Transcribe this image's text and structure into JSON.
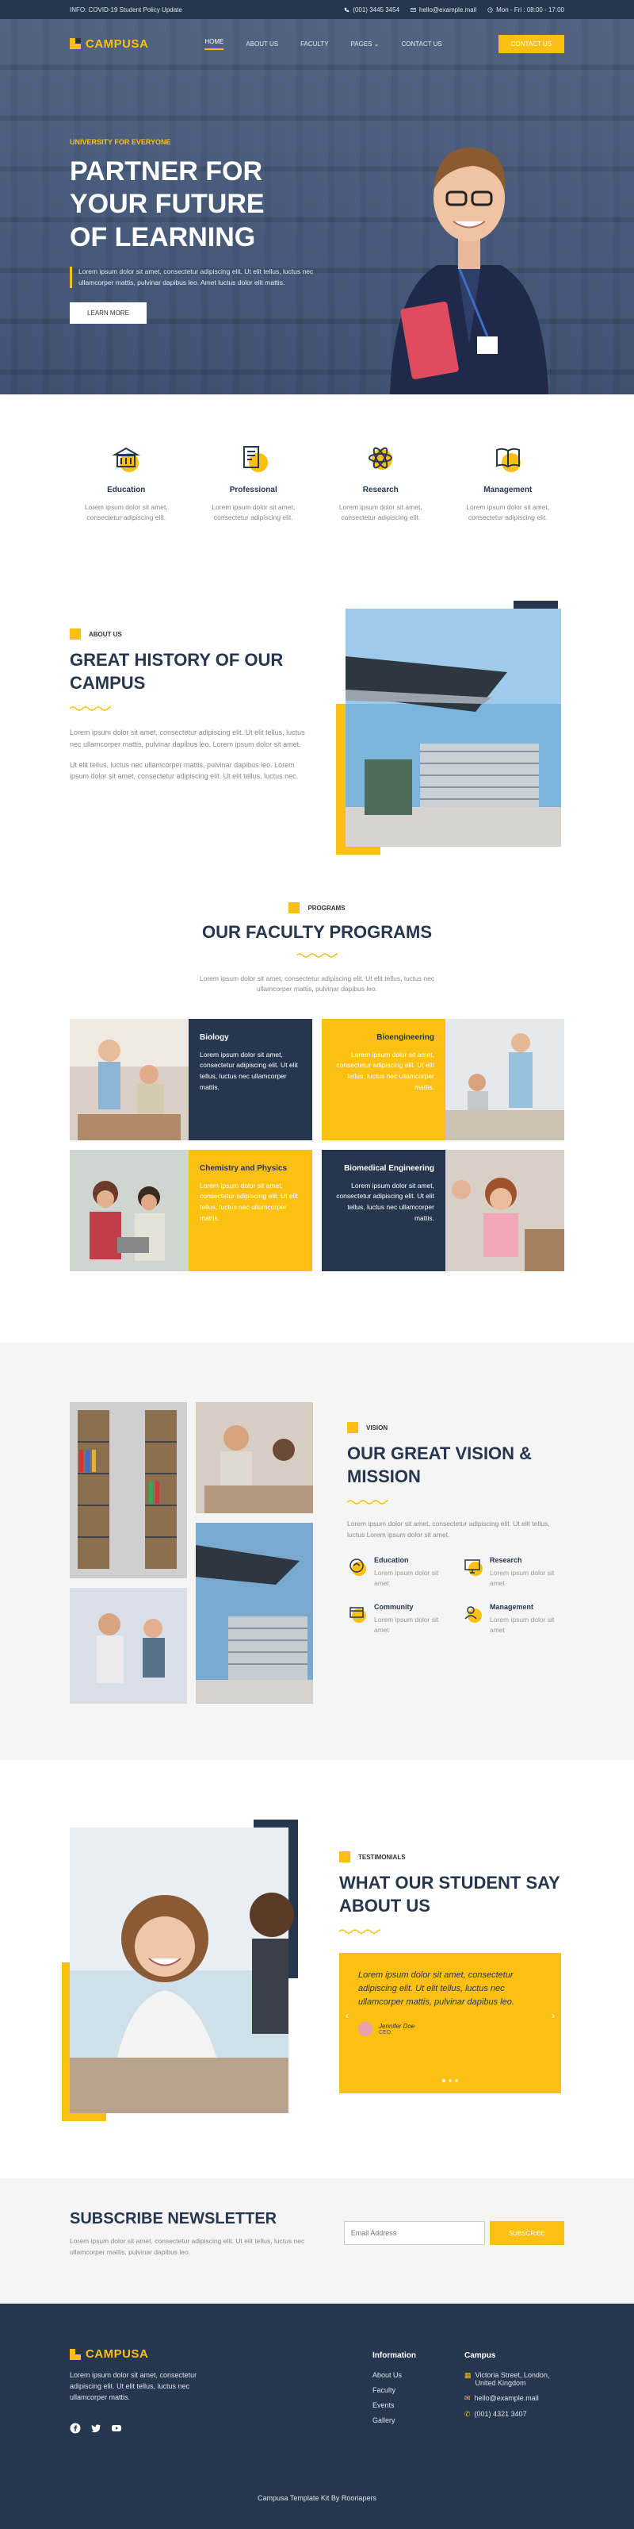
{
  "topbar": {
    "info": "INFO: COVID-19 Student Policy Update",
    "phone": "(001) 3445 3454",
    "email": "hello@example.mail",
    "hours": "Mon - Fri : 08:00 - 17:00"
  },
  "nav": {
    "logo": "CAMPUSA",
    "items": [
      "HOME",
      "ABOUT US",
      "FACULTY",
      "PAGES",
      "CONTACT US"
    ],
    "cta": "CONTACT US"
  },
  "hero": {
    "eyebrow": "UNIVERSITY FOR EVERYONE",
    "title": "PARTNER FOR\nYOUR FUTURE\nOF LEARNING",
    "desc": "Lorem ipsum dolor sit amet, consectetur adipiscing elit. Ut elit tellus, luctus nec ullamcorper mattis, pulvinar dapibus leo. Amet luctus dolor elit mattis.",
    "button": "LEARN MORE"
  },
  "features": [
    {
      "title": "Education",
      "text": "Lorem ipsum dolor sit amet, consectetur adipiscing elit.",
      "icon": "graduation-building-icon"
    },
    {
      "title": "Professional",
      "text": "Lorem ipsum dolor sit amet, consectetur adipiscing elit.",
      "icon": "book-certificate-icon"
    },
    {
      "title": "Research",
      "text": "Lorem ipsum dolor sit amet, consectetur adipiscing elit.",
      "icon": "atom-icon"
    },
    {
      "title": "Management",
      "text": "Lorem ipsum dolor sit amet, consectetur adipiscing elit.",
      "icon": "open-book-icon"
    }
  ],
  "about": {
    "label": "ABOUT US",
    "title": "GREAT HISTORY OF OUR CAMPUS",
    "p1": "Lorem ipsum dolor sit amet, consectetur adipiscing elit. Ut elit tellus, luctus nec ullamcorper mattis, pulvinar dapibus leo. Lorem ipsum dolor sit amet.",
    "p2": "Ut elit tellus, luctus nec ullamcorper mattis, pulvinar dapibus leo. Lorem ipsum dolor sit amet, consectetur adipiscing elit. Ut elit tellus, luctus nec."
  },
  "programs": {
    "label": "PROGRAMS",
    "title": "OUR FACULTY PROGRAMS",
    "desc": "Lorem ipsum dolor sit amet, consectetur adipiscing elit. Ut elit tellus, luctus nec ullamcorper mattis, pulvinar dapibus leo.",
    "items": [
      {
        "title": "Biology",
        "text": "Lorem ipsum dolor sit amet, consectetur adipiscing elit. Ut elit tellus, luctus nec ullamcorper mattis."
      },
      {
        "title": "Bioengineering",
        "text": "Lorem ipsum dolor sit amet, consectetur adipiscing elit. Ut elit tellus, luctus nec ullamcorper mattis."
      },
      {
        "title": "Chemistry and Physics",
        "text": "Lorem ipsum dolor sit amet, consectetur adipiscing elit. Ut elit tellus, luctus nec ullamcorper mattis."
      },
      {
        "title": "Biomedical Engineering",
        "text": "Lorem ipsum dolor sit amet, consectetur adipiscing elit. Ut elit tellus, luctus nec ullamcorper mattis."
      }
    ]
  },
  "vision": {
    "label": "VISION",
    "title": "OUR GREAT VISION & MISSION",
    "desc": "Lorem ipsum dolor sit amet, consectetur adipiscing elit. Ut elit tellus, luctus Lorem ipsum dolor sit amet.",
    "items": [
      {
        "title": "Education",
        "text": "Lorem ipsum dolor sit amet"
      },
      {
        "title": "Research",
        "text": "Lorem ipsum dolor sit amet"
      },
      {
        "title": "Community",
        "text": "Lorem ipsum dolor sit amet"
      },
      {
        "title": "Management",
        "text": "Lorem ipsum dolor sit amet"
      }
    ]
  },
  "testimonials": {
    "label": "TESTIMONIALS",
    "title": "WHAT OUR STUDENT SAY ABOUT US",
    "quote": "Lorem ipsum dolor sit amet, consectetur adipiscing elit. Ut elit tellus, luctus nec ullamcorper mattis, pulvinar dapibus leo.",
    "name": "Jennifer Doe",
    "role": "CEO"
  },
  "subscribe": {
    "title": "SUBSCRIBE NEWSLETTER",
    "desc": "Lorem ipsum dolor sit amet, consectetur adipiscing elit. Ut elit tellus, luctus nec ullamcorper mattis, pulvinar dapibus leo.",
    "placeholder": "Email Address",
    "button": "SUBSCRIBE"
  },
  "footer": {
    "logo": "CAMPUSA",
    "desc": "Lorem ipsum dolor sit amet, consectetur adipiscing elit. Ut elit tellus, luctus nec ullamcorper mattis.",
    "info_title": "Information",
    "info_links": [
      "About Us",
      "Faculty",
      "Events",
      "Gallery"
    ],
    "campus_title": "Campus",
    "address": "Victoria Street, London, United Kingdom",
    "email": "hello@example.mail",
    "phone": "(001) 4321 3407",
    "copyright": "Campusa Template Kit By Rooriapers"
  },
  "colors": {
    "navy": "#26364f",
    "yellow": "#fbc011"
  }
}
